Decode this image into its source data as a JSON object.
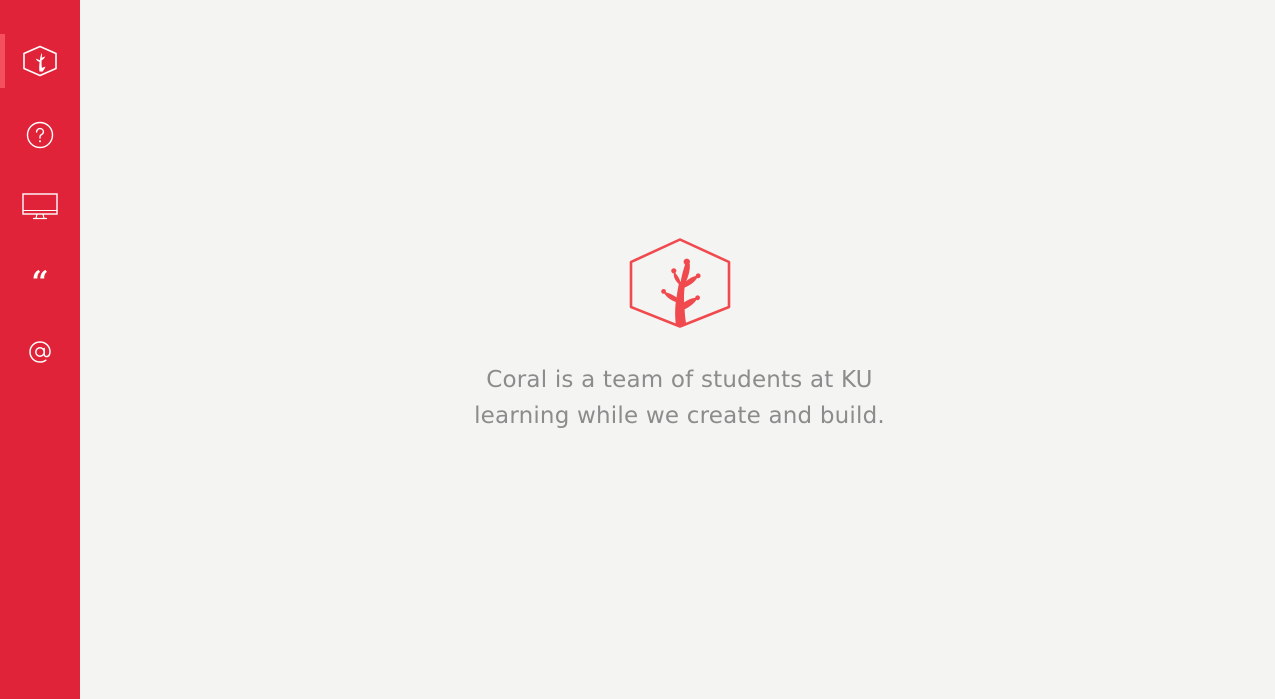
{
  "sidebar": {
    "items": [
      {
        "id": "home",
        "icon": "coral-logo-icon",
        "active": true
      },
      {
        "id": "about",
        "icon": "question-circle-icon",
        "active": false
      },
      {
        "id": "work",
        "icon": "monitor-icon",
        "active": false
      },
      {
        "id": "testimonials",
        "icon": "quote-icon",
        "active": false,
        "glyph": "“"
      },
      {
        "id": "contact",
        "icon": "at-sign-icon",
        "active": false,
        "glyph": "@"
      }
    ]
  },
  "hero": {
    "logo_icon": "coral-logo-icon",
    "tagline_line1": "Coral is a team of students at KU",
    "tagline_line2": "learning while we create and build."
  },
  "colors": {
    "sidebar_bg": "#e02339",
    "active_indicator": "#f4505e",
    "page_bg": "#f4f4f2",
    "logo_red": "#f04a4e",
    "tagline_text": "#8c8c8c"
  }
}
